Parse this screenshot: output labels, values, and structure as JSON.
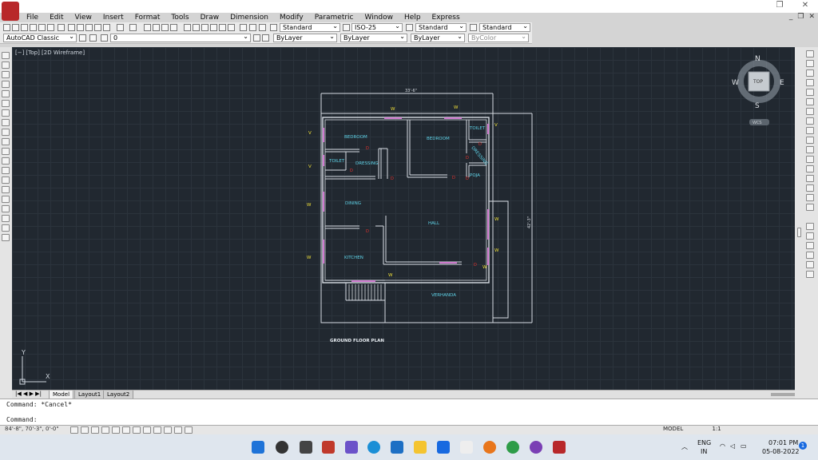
{
  "menu": {
    "items": [
      "File",
      "Edit",
      "View",
      "Insert",
      "Format",
      "Tools",
      "Draw",
      "Dimension",
      "Modify",
      "Parametric",
      "Window",
      "Help",
      "Express"
    ]
  },
  "toolbar": {
    "text_style": "Standard",
    "dim_style": "ISO-25",
    "table_style": "Standard",
    "multileader_style": "Standard",
    "workspace": "AutoCAD Classic",
    "layer": "0",
    "color": "ByLayer",
    "linetype": "ByLayer",
    "lineweight": "ByLayer",
    "plot_style": "ByColor"
  },
  "viewport": {
    "label": "[−] [Top] [2D Wireframe]"
  },
  "viewcube": {
    "north": "N",
    "south": "S",
    "east": "E",
    "west": "W",
    "face": "TOP",
    "wcs": "WCS"
  },
  "ucs": {
    "x": "X",
    "y": "Y"
  },
  "drawing": {
    "width_dim": "33'-6\"",
    "height_dim": "42'-3\"",
    "title": "GROUND FLOOR PLAN",
    "rooms": {
      "bedroom1": "BEDROOM",
      "bedroom2": "BEDROOM",
      "toilet1": "TOILET",
      "toilet2": "TOILET",
      "dressing1": "DRESSING",
      "dressing2": "DRESSING",
      "pooja": "POJA",
      "dining": "DINING",
      "hall": "HALL",
      "kitchen": "KITCHEN",
      "verhanda": "VERHANDA"
    },
    "window_tag": "W",
    "vent_tag": "V",
    "door_tag": "D"
  },
  "tabs": [
    "Model",
    "Layout1",
    "Layout2"
  ],
  "command": {
    "history": "Command: *Cancel*",
    "prompt": "Command:"
  },
  "status": {
    "coords": "84'-8\", 70'-3\", 0'-0\"",
    "model": "MODEL",
    "scale": "1:1"
  },
  "tray": {
    "lang1": "ENG",
    "lang2": "IN",
    "time": "07:01 PM",
    "date": "05-08-2022",
    "notif": "1"
  },
  "colors": {
    "canvas": "#212830",
    "wall": "#d8dde3",
    "room_label": "#5fd3e8",
    "window_tag": "#f2e23a",
    "door_tag": "#e8312e",
    "opening": "#d07bd0"
  }
}
